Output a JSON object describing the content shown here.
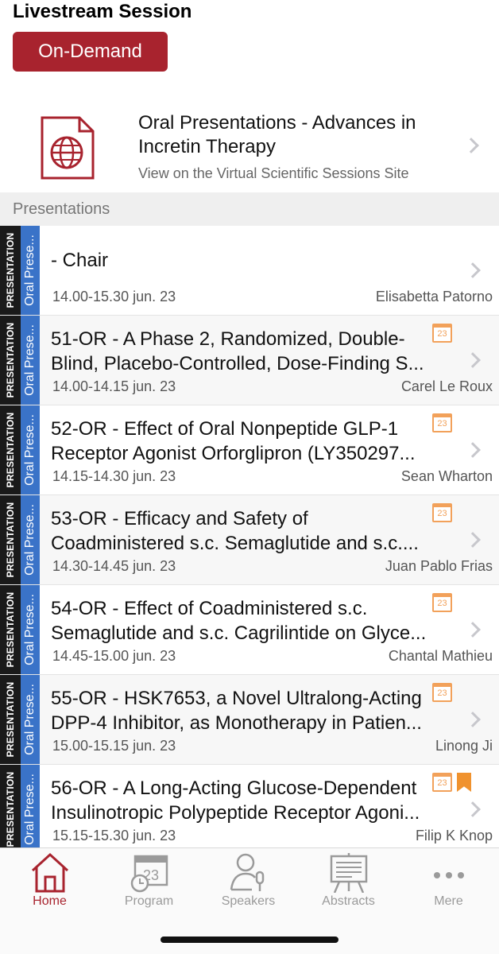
{
  "header": {
    "title": "Livestream Session",
    "on_demand_label": "On-Demand"
  },
  "session": {
    "title_line1": "Oral Presentations - Advances in",
    "title_line2": "Incretin Therapy",
    "subtitle": "View on the Virtual Scientific Sessions Site",
    "icon": "globe-document-icon"
  },
  "section": {
    "label": "Presentations"
  },
  "presentations": [
    {
      "type_tag": "PRESENTATION",
      "session_tag": "Oral Prese...",
      "title_line1": "- Chair",
      "title_line2": "",
      "time": "14.00-15.30  jun. 23",
      "speaker": "Elisabetta Patorno",
      "calendar": false,
      "bookmark": false
    },
    {
      "type_tag": "PRESENTATION",
      "session_tag": "Oral Prese...",
      "title_line1": "51-OR - A Phase 2, Randomized, Double-",
      "title_line2": "Blind, Placebo-Controlled, Dose-Finding S...",
      "time": "14.00-14.15  jun. 23",
      "speaker": "Carel Le Roux",
      "calendar": true,
      "calendar_label": "23",
      "bookmark": false
    },
    {
      "type_tag": "PRESENTATION",
      "session_tag": "Oral Prese...",
      "title_line1": "52-OR - Effect of Oral Nonpeptide GLP-1",
      "title_line2": "Receptor Agonist Orforglipron (LY350297...",
      "time": "14.15-14.30  jun. 23",
      "speaker": "Sean Wharton",
      "calendar": true,
      "calendar_label": "23",
      "bookmark": false
    },
    {
      "type_tag": "PRESENTATION",
      "session_tag": "Oral Prese...",
      "title_line1": "53-OR - Efficacy and Safety of",
      "title_line2": "Coadministered s.c. Semaglutide and s.c....",
      "time": "14.30-14.45  jun. 23",
      "speaker": "Juan Pablo Frias",
      "calendar": true,
      "calendar_label": "23",
      "bookmark": false
    },
    {
      "type_tag": "PRESENTATION",
      "session_tag": "Oral Prese...",
      "title_line1": "54-OR - Effect of Coadministered s.c.",
      "title_line2": "Semaglutide and s.c. Cagrilintide on Glyce...",
      "time": "14.45-15.00  jun. 23",
      "speaker": "Chantal Mathieu",
      "calendar": true,
      "calendar_label": "23",
      "bookmark": false
    },
    {
      "type_tag": "PRESENTATION",
      "session_tag": "Oral Prese...",
      "title_line1": "55-OR - HSK7653, a Novel Ultralong-Acting",
      "title_line2": "DPP-4 Inhibitor, as Monotherapy in Patien...",
      "time": "15.00-15.15  jun. 23",
      "speaker": "Linong Ji",
      "calendar": true,
      "calendar_label": "23",
      "bookmark": false
    },
    {
      "type_tag": "PRESENTATION",
      "session_tag": "Oral Prese...",
      "title_line1": "56-OR - A Long-Acting Glucose-Dependent",
      "title_line2": "Insulinotropic Polypeptide Receptor Agoni...",
      "time": "15.15-15.30  jun. 23",
      "speaker": "Filip K Knop",
      "calendar": true,
      "calendar_label": "23",
      "bookmark": true
    }
  ],
  "tabbar": {
    "tabs": [
      {
        "label": "Home",
        "icon": "home-icon",
        "active": true
      },
      {
        "label": "Program",
        "icon": "calendar-clock-icon",
        "active": false,
        "icon_text": "23"
      },
      {
        "label": "Speakers",
        "icon": "speaker-icon",
        "active": false
      },
      {
        "label": "Abstracts",
        "icon": "easel-icon",
        "active": false
      },
      {
        "label": "Mere",
        "icon": "more-dots-icon",
        "active": false
      }
    ]
  },
  "colors": {
    "brand_red": "#a8232e",
    "tag_blue": "#3a73c8",
    "tag_black": "#1a1a1a",
    "calendar_orange": "#f2a15a",
    "bookmark_orange": "#f0922e"
  }
}
